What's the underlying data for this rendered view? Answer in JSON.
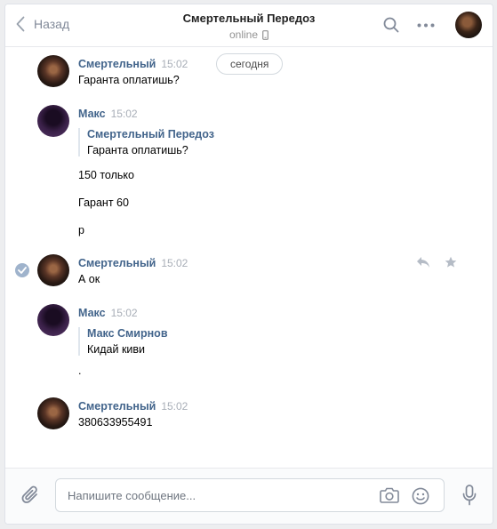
{
  "header": {
    "back_label": "Назад",
    "title": "Смертельный Передоз",
    "status": "online"
  },
  "date_divider": "сегодня",
  "messages": [
    {
      "author": "Смертельный",
      "time": "15:02",
      "text": "Гаранта оплатишь?"
    },
    {
      "author": "Макс",
      "time": "15:02",
      "quote": {
        "author": "Смертельный Передоз",
        "text": "Гаранта оплатишь?"
      },
      "lines": [
        "150 только",
        "Гарант 60",
        "р"
      ]
    },
    {
      "author": "Смертельный",
      "time": "15:02",
      "text": "А ок"
    },
    {
      "author": "Макс",
      "time": "15:02",
      "quote": {
        "author": "Макс Смирнов",
        "text": "Кидай киви"
      },
      "lines": [
        "."
      ]
    },
    {
      "author": "Смертельный",
      "time": "15:02",
      "text": "380633955491"
    }
  ],
  "composer": {
    "placeholder": "Напишите сообщение..."
  },
  "icons": {
    "back": "chevron-left-icon",
    "search": "search-icon",
    "more": "more-dots-icon",
    "phone": "mobile-phone-icon",
    "reply": "reply-icon",
    "star": "star-icon",
    "attach": "paperclip-icon",
    "camera": "camera-icon",
    "smile": "smile-icon",
    "mic": "microphone-icon",
    "check": "check-icon"
  },
  "colors": {
    "author": "#42648b",
    "time": "#a8aeb7",
    "icon": "#828a99",
    "selected_check": "#9fb3cc"
  }
}
